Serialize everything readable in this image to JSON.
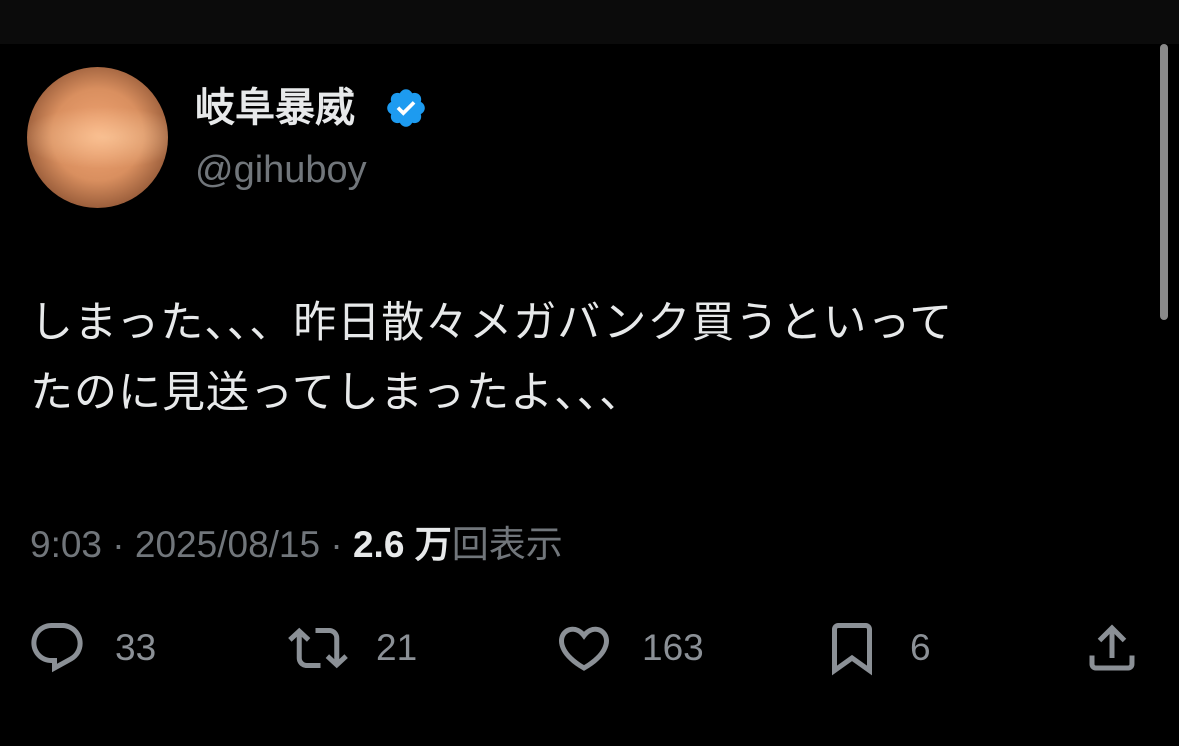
{
  "author": {
    "display_name": "岐阜暴威",
    "handle": "@gihuboy",
    "verified_color": "#1d9bf0"
  },
  "tweet": {
    "text_line1": "しまった、、、昨日散々メガバンク買うといって",
    "text_line2": "たのに見送ってしまったよ、、、"
  },
  "meta": {
    "time": "9:03",
    "separator": " · ",
    "date": "2025/08/15",
    "views_count": "2.6 万",
    "views_label": "回表示"
  },
  "actions": {
    "reply": {
      "icon": "reply-icon",
      "count": "33"
    },
    "retweet": {
      "icon": "retweet-icon",
      "count": "21"
    },
    "like": {
      "icon": "heart-icon",
      "count": "163"
    },
    "bookmark": {
      "icon": "bookmark-icon",
      "count": "6"
    },
    "share": {
      "icon": "share-icon"
    }
  },
  "colors": {
    "background": "#000000",
    "text_primary": "#e7e9ea",
    "text_secondary": "#71767b",
    "icon": "#8b9096"
  }
}
